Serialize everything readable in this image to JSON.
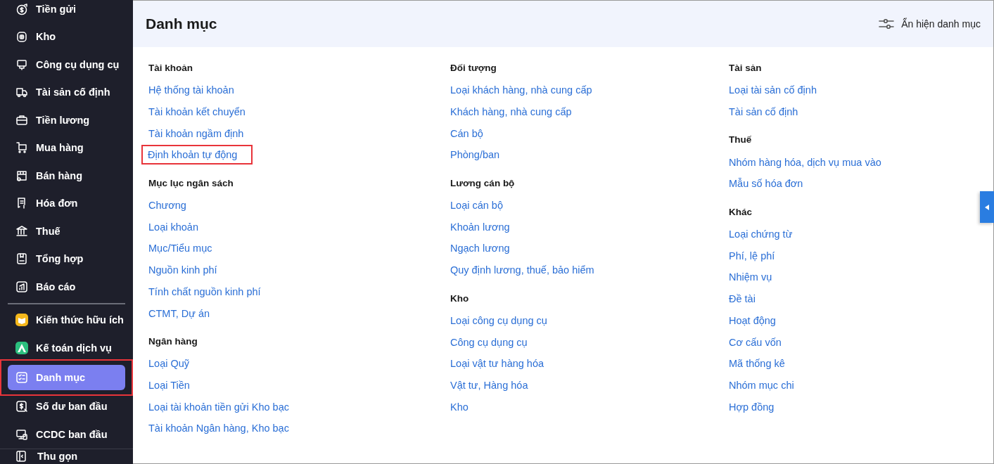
{
  "sidebar": {
    "groups": [
      [
        {
          "label": "Tiền gửi",
          "selected": false,
          "highlighted": false
        },
        {
          "label": "Kho",
          "selected": false,
          "highlighted": false
        },
        {
          "label": "Công cụ dụng cụ",
          "selected": false,
          "highlighted": false
        },
        {
          "label": "Tài sản cố định",
          "selected": false,
          "highlighted": false
        },
        {
          "label": "Tiền lương",
          "selected": false,
          "highlighted": false
        },
        {
          "label": "Mua hàng",
          "selected": false,
          "highlighted": false
        },
        {
          "label": "Bán hàng",
          "selected": false,
          "highlighted": false
        },
        {
          "label": "Hóa đơn",
          "selected": false,
          "highlighted": false
        },
        {
          "label": "Thuế",
          "selected": false,
          "highlighted": false
        },
        {
          "label": "Tổng hợp",
          "selected": false,
          "highlighted": false
        },
        {
          "label": "Báo cáo",
          "selected": false,
          "highlighted": false
        }
      ],
      [
        {
          "label": "Kiến thức hữu ích",
          "selected": false,
          "highlighted": false
        },
        {
          "label": "Kế toán dịch vụ",
          "selected": false,
          "highlighted": false
        },
        {
          "label": "Danh mục",
          "selected": true,
          "highlighted": true
        },
        {
          "label": "Số dư ban đầu",
          "selected": false,
          "highlighted": false
        },
        {
          "label": "CCDC ban đầu",
          "selected": false,
          "highlighted": false
        }
      ]
    ],
    "collapse_button": "Thu gọn"
  },
  "header": {
    "title": "Danh mục",
    "toggle_button": "Ẩn hiện danh mục"
  },
  "columns": [
    [
      {
        "title": "Tài khoản",
        "links": [
          {
            "label": "Hệ thống tài khoản",
            "highlighted": false
          },
          {
            "label": "Tài khoản kết chuyển",
            "highlighted": false
          },
          {
            "label": "Tài khoản ngầm định",
            "highlighted": false
          },
          {
            "label": "Định khoản tự động",
            "highlighted": true
          }
        ]
      },
      {
        "title": "Mục lục ngân sách",
        "links": [
          {
            "label": "Chương",
            "highlighted": false
          },
          {
            "label": "Loại khoản",
            "highlighted": false
          },
          {
            "label": "Mục/Tiểu mục",
            "highlighted": false
          },
          {
            "label": "Nguồn kinh phí",
            "highlighted": false
          },
          {
            "label": "Tính chất nguồn kinh phí",
            "highlighted": false
          },
          {
            "label": "CTMT, Dự án",
            "highlighted": false
          }
        ]
      },
      {
        "title": "Ngân hàng",
        "links": [
          {
            "label": "Loại Quỹ",
            "highlighted": false
          },
          {
            "label": "Loại Tiền",
            "highlighted": false
          },
          {
            "label": "Loại tài khoản tiền gửi Kho bạc",
            "highlighted": false
          },
          {
            "label": "Tài khoản Ngân hàng, Kho bạc",
            "highlighted": false
          }
        ]
      }
    ],
    [
      {
        "title": "Đối tượng",
        "links": [
          {
            "label": "Loại khách hàng, nhà cung cấp",
            "highlighted": false
          },
          {
            "label": "Khách hàng, nhà cung cấp",
            "highlighted": false
          },
          {
            "label": "Cán bộ",
            "highlighted": false
          },
          {
            "label": "Phòng/ban",
            "highlighted": false
          }
        ]
      },
      {
        "title": "Lương cán bộ",
        "links": [
          {
            "label": "Loại cán bộ",
            "highlighted": false
          },
          {
            "label": "Khoản lương",
            "highlighted": false
          },
          {
            "label": "Ngạch lương",
            "highlighted": false
          },
          {
            "label": "Quy định lương, thuế, bảo hiểm",
            "highlighted": false
          }
        ]
      },
      {
        "title": "Kho",
        "links": [
          {
            "label": "Loại công cụ dụng cụ",
            "highlighted": false
          },
          {
            "label": "Công cụ dụng cụ",
            "highlighted": false
          },
          {
            "label": "Loại vật tư hàng hóa",
            "highlighted": false
          },
          {
            "label": "Vật tư, Hàng hóa",
            "highlighted": false
          },
          {
            "label": "Kho",
            "highlighted": false
          }
        ]
      }
    ],
    [
      {
        "title": "Tài sản",
        "links": [
          {
            "label": "Loại tài sản cố định",
            "highlighted": false
          },
          {
            "label": "Tài sản cố định",
            "highlighted": false
          }
        ]
      },
      {
        "title": "Thuế",
        "links": [
          {
            "label": "Nhóm hàng hóa, dịch vụ mua vào",
            "highlighted": false
          },
          {
            "label": "Mẫu số hóa đơn",
            "highlighted": false
          }
        ]
      },
      {
        "title": "Khác",
        "links": [
          {
            "label": "Loại chứng từ",
            "highlighted": false
          },
          {
            "label": "Phí, lệ phí",
            "highlighted": false
          },
          {
            "label": "Nhiệm vụ",
            "highlighted": false
          },
          {
            "label": "Đề tài",
            "highlighted": false
          },
          {
            "label": "Hoạt động",
            "highlighted": false
          },
          {
            "label": "Cơ cấu vốn",
            "highlighted": false
          },
          {
            "label": "Mã thống kê",
            "highlighted": false
          },
          {
            "label": "Nhóm mục chi",
            "highlighted": false
          },
          {
            "label": "Hợp đồng",
            "highlighted": false
          }
        ]
      }
    ]
  ]
}
